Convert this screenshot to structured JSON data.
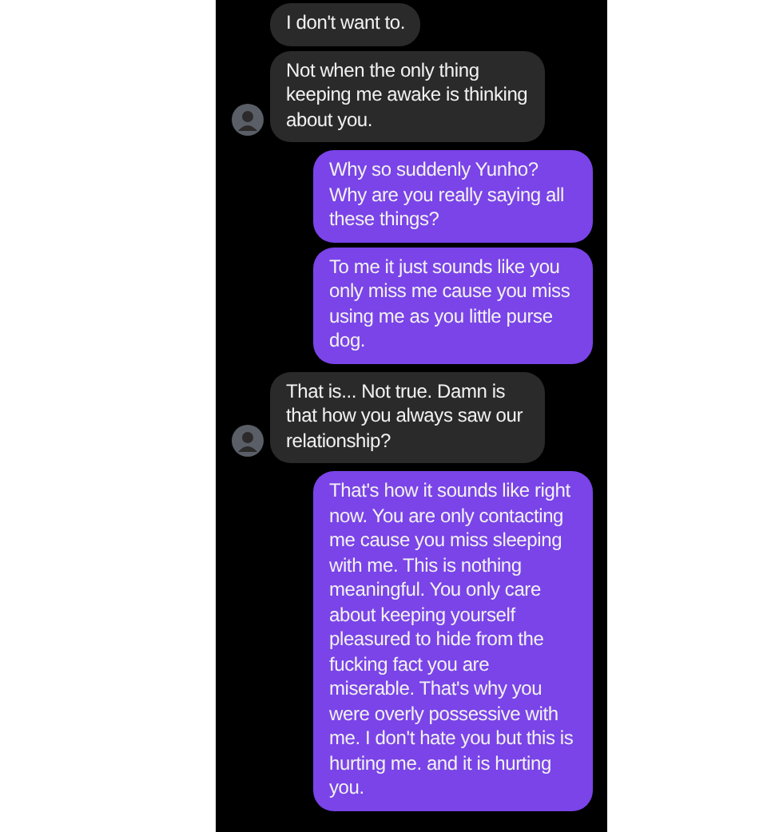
{
  "groups": [
    {
      "kind": "incoming",
      "messages": [
        "I don't want to.",
        "Not when the only thing keeping me awake is thinking about you."
      ]
    },
    {
      "kind": "outgoing",
      "messages": [
        "Why so suddenly Yunho? Why are you really saying all these things?",
        "To me it just sounds like you only miss me cause you miss using me as you little purse dog."
      ]
    },
    {
      "kind": "incoming",
      "messages": [
        "That is... Not true. Damn is that how you always saw our relationship?"
      ]
    },
    {
      "kind": "outgoing",
      "messages": [
        "That's how it sounds like right now. You are only contacting me cause you miss sleeping with me. This is nothing meaningful. You only care about keeping yourself pleasured to hide from the fucking fact you are miserable. That's why you were overly possessive with me. I don't hate you but this is hurting me. and it is hurting you."
      ]
    }
  ]
}
